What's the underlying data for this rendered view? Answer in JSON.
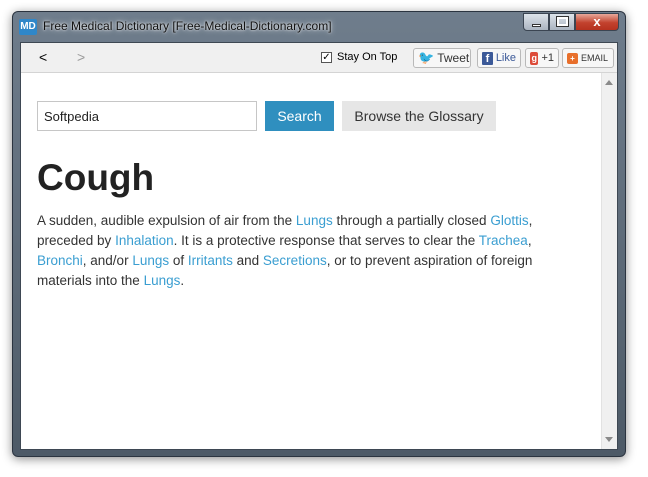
{
  "window": {
    "app_icon": "MD",
    "title": "Free Medical Dictionary [Free-Medical-Dictionary.com]",
    "close_glyph": "x"
  },
  "toolbar": {
    "back": "<",
    "forward": ">",
    "stay_on_top_label": "Stay On Top",
    "stay_on_top_checked": true,
    "tweet_label": "Tweet",
    "like_label": "Like",
    "gplus_label": "+1",
    "gplus_glyph": "g",
    "email_label": "EMAIL"
  },
  "search": {
    "value": "Softpedia",
    "button_label": "Search",
    "glossary_label": "Browse the Glossary"
  },
  "entry": {
    "term": "Cough",
    "definition": [
      {
        "text": "A sudden, audible expulsion of air from the ",
        "link": false
      },
      {
        "text": "Lungs",
        "link": true
      },
      {
        "text": " through a partially closed ",
        "link": false
      },
      {
        "text": "Glottis",
        "link": true
      },
      {
        "text": ", preceded by ",
        "link": false
      },
      {
        "text": "Inhalation",
        "link": true
      },
      {
        "text": ". It is a protective response that serves to clear the ",
        "link": false
      },
      {
        "text": "Trachea",
        "link": true
      },
      {
        "text": ", ",
        "link": false
      },
      {
        "text": "Bronchi",
        "link": true
      },
      {
        "text": ", and/or ",
        "link": false
      },
      {
        "text": "Lungs",
        "link": true
      },
      {
        "text": " of ",
        "link": false
      },
      {
        "text": "Irritants",
        "link": true
      },
      {
        "text": " and ",
        "link": false
      },
      {
        "text": "Secretions",
        "link": true
      },
      {
        "text": ", or to prevent aspiration of foreign materials into the ",
        "link": false
      },
      {
        "text": "Lungs",
        "link": true
      },
      {
        "text": ".",
        "link": false
      }
    ]
  },
  "colors": {
    "accent": "#2f8fbf",
    "link": "#3a9ed1"
  }
}
